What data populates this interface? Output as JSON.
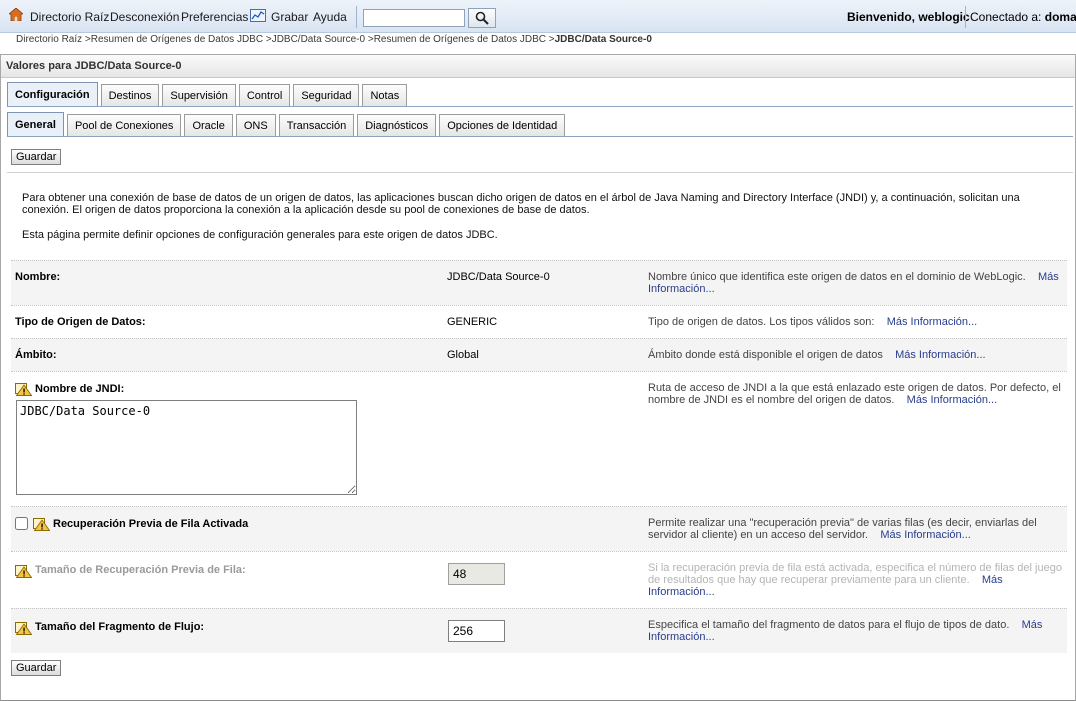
{
  "topbar": {
    "home_label": "Directorio Raíz",
    "logout_label": "Desconexión",
    "preferences_label": "Preferencias",
    "record_label": "Grabar",
    "help_label": "Ayuda",
    "search_value": "",
    "welcome_text": "Bienvenido, weblogic",
    "connected_prefix": "Conectado a:",
    "connected_domain": "domain"
  },
  "breadcrumb": {
    "items": [
      "Directorio Raíz >",
      "Resumen de Orígenes de Datos JDBC >",
      "JDBC/Data Source-0 >",
      "Resumen de Orígenes de Datos JDBC >"
    ],
    "current": "JDBC/Data Source-0"
  },
  "panel": {
    "title": "Valores para JDBC/Data Source-0",
    "main_tabs": [
      "Configuración",
      "Destinos",
      "Supervisión",
      "Control",
      "Seguridad",
      "Notas"
    ],
    "sub_tabs": [
      "General",
      "Pool de Conexiones",
      "Oracle",
      "ONS",
      "Transacción",
      "Diagnósticos",
      "Opciones de Identidad"
    ],
    "save_label": "Guardar",
    "intro_1": "Para obtener una conexión de base de datos de un origen de datos, las aplicaciones buscan dicho origen de datos en el árbol de Java Naming and Directory Interface (JNDI) y, a continuación, solicitan una conexión. El origen de datos proporciona la conexión a la aplicación desde su pool de conexiones de base de datos.",
    "intro_2": "Esta página permite definir opciones de configuración generales para este origen de datos JDBC."
  },
  "more_info": "Más Información...",
  "fields": {
    "name": {
      "label": "Nombre:",
      "value": "JDBC/Data Source-0",
      "help": "Nombre único que identifica este origen de datos en el dominio de WebLogic."
    },
    "type": {
      "label": "Tipo de Origen de Datos:",
      "value": "GENERIC",
      "help": "Tipo de origen de datos. Los tipos válidos son:"
    },
    "scope": {
      "label": "Ámbito:",
      "value": "Global",
      "help": "Ámbito donde está disponible el origen de datos"
    },
    "jndi": {
      "label": "Nombre de JNDI:",
      "value": "JDBC/Data Source-0",
      "help": "Ruta de acceso de JNDI a la que está enlazado este origen de datos. Por defecto, el nombre de JNDI es el nombre del origen de datos."
    },
    "prefetch": {
      "label": "Recuperación Previa de Fila Activada",
      "checked": false,
      "help": "Permite realizar una \"recuperación previa\" de varias filas (es decir, enviarlas del servidor al cliente) en un acceso del servidor."
    },
    "prefetch_size": {
      "label": "Tamaño de Recuperación Previa de Fila:",
      "value": "48",
      "help": "Si la recuperación previa de fila está activada, especifica el número de filas del juego de resultados que hay que recuperar previamente para un cliente."
    },
    "stream_chunk": {
      "label": "Tamaño del Fragmento de Flujo:",
      "value": "256",
      "help": "Especifica el tamaño del fragmento de datos para el flujo de tipos de dato."
    }
  },
  "colors": {
    "accent_link": "#273d8c",
    "topbar_bg": "#d9e4f2",
    "active_tab_bg": "#eaf0f8"
  }
}
